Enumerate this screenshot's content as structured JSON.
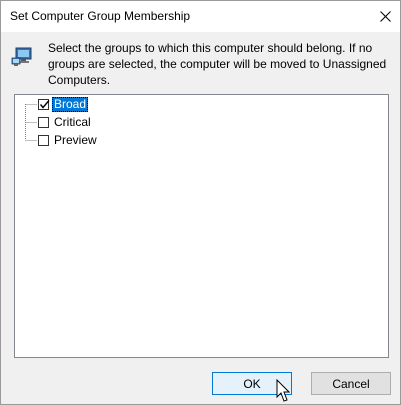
{
  "window": {
    "title": "Set Computer Group Membership",
    "close_icon": "close-icon"
  },
  "instruction": {
    "icon": "computer-network-icon",
    "text": "Select the groups to which this computer should belong. If no groups are selected, the computer will be moved to Unassigned Computers."
  },
  "groups": [
    {
      "label": "Broad",
      "checked": true,
      "selected": true
    },
    {
      "label": "Critical",
      "checked": false,
      "selected": false
    },
    {
      "label": "Preview",
      "checked": false,
      "selected": false
    }
  ],
  "buttons": {
    "ok": "OK",
    "cancel": "Cancel"
  },
  "colors": {
    "selection": "#0078d7",
    "dialog_bg": "#f0f0f0"
  }
}
